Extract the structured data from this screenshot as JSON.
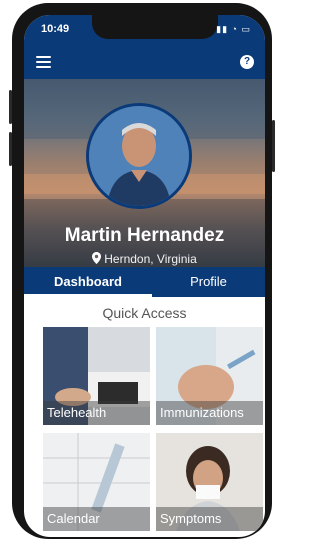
{
  "status_bar": {
    "time": "10:49",
    "icons": "▮▮ ◔ ▭"
  },
  "nav": {
    "help_label": "?"
  },
  "profile": {
    "name": "Martin Hernandez",
    "location": "Herndon, Virginia"
  },
  "tabs": [
    {
      "label": "Dashboard",
      "active": true
    },
    {
      "label": "Profile",
      "active": false
    }
  ],
  "quick_access": {
    "title": "Quick Access",
    "tiles": [
      {
        "label": "Telehealth"
      },
      {
        "label": "Immunizations"
      },
      {
        "label": "Calendar"
      },
      {
        "label": "Symptoms"
      }
    ]
  },
  "colors": {
    "brand": "#0b3a78",
    "background": "#ffffff"
  }
}
